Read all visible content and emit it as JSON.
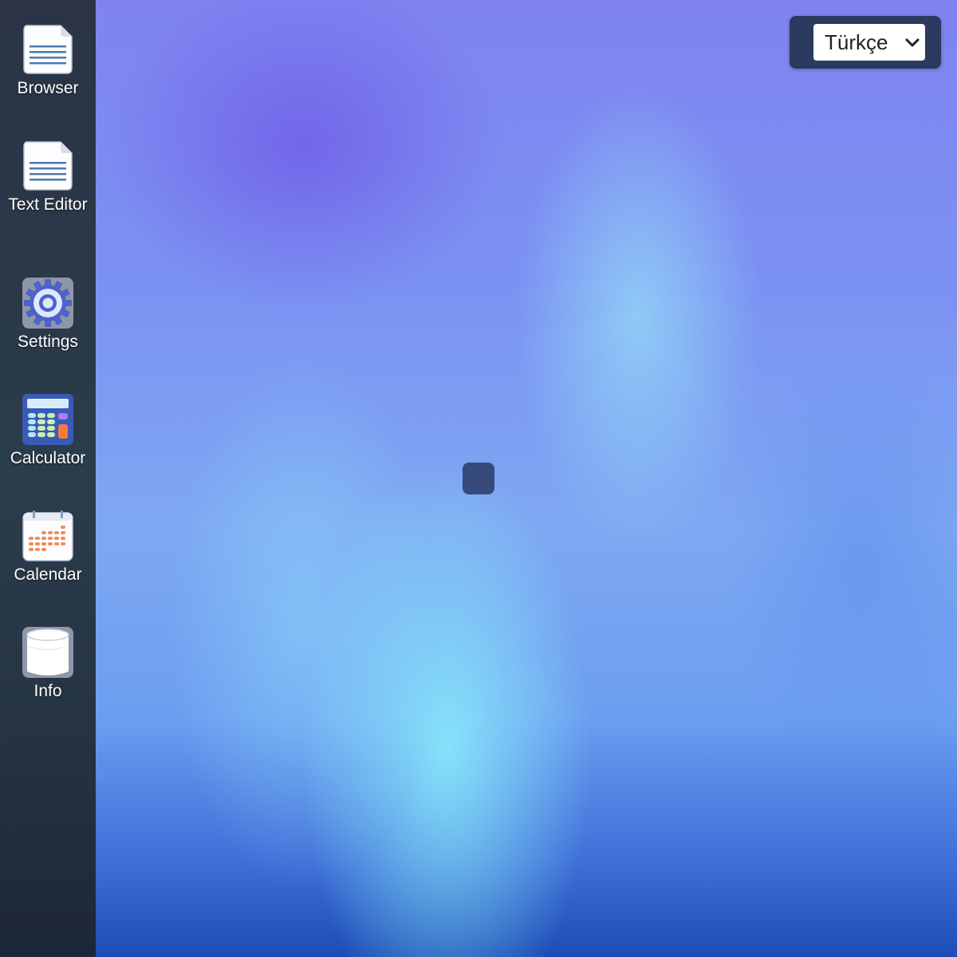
{
  "desktop": {
    "apps": [
      {
        "id": "browser",
        "label": "Browser",
        "icon": "document-icon"
      },
      {
        "id": "text-editor",
        "label": "Text Editor",
        "icon": "document-icon"
      },
      {
        "id": "settings",
        "label": "Settings",
        "icon": "gear-icon"
      },
      {
        "id": "calculator",
        "label": "Calculator",
        "icon": "calculator-icon"
      },
      {
        "id": "calendar",
        "label": "Calendar",
        "icon": "calendar-icon"
      },
      {
        "id": "info",
        "label": "Info",
        "icon": "database-icon"
      }
    ]
  },
  "language": {
    "selected": "Türkçe",
    "icon": "chevron-down-icon"
  },
  "colors": {
    "sidebar": "#2a3446",
    "panel": "#2b3a5e",
    "center_square": "#364a7c"
  }
}
